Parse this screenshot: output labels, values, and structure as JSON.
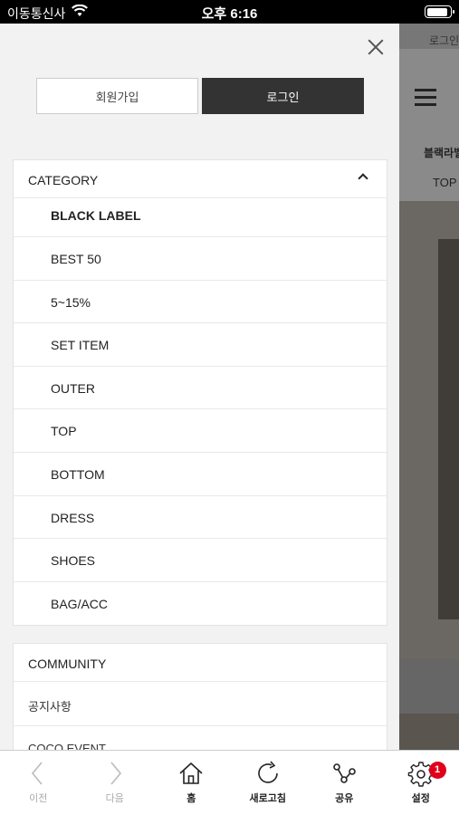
{
  "status_bar": {
    "carrier": "이동통신사",
    "time": "오후 6:16",
    "battery_level": 0.95
  },
  "background_page": {
    "login_label": "로그인",
    "label_1": "블랙라벨",
    "label_2": "TOP"
  },
  "drawer": {
    "join_label": "회원가입",
    "login_label": "로그인",
    "category": {
      "title": "CATEGORY",
      "items": [
        "BLACK LABEL",
        "BEST 50",
        "5~15%",
        "SET ITEM",
        "OUTER",
        "TOP",
        "BOTTOM",
        "DRESS",
        "SHOES",
        "BAG/ACC"
      ]
    },
    "community": {
      "title": "COMMUNITY",
      "items": [
        "공지사항",
        "COCO EVENT"
      ]
    }
  },
  "toolbar": {
    "items": [
      {
        "label": "이전",
        "icon": "chevron-left-icon",
        "enabled": false
      },
      {
        "label": "다음",
        "icon": "chevron-right-icon",
        "enabled": false
      },
      {
        "label": "홈",
        "icon": "home-icon",
        "enabled": true
      },
      {
        "label": "새로고침",
        "icon": "refresh-icon",
        "enabled": true
      },
      {
        "label": "공유",
        "icon": "share-icon",
        "enabled": true
      },
      {
        "label": "설정",
        "icon": "gear-icon",
        "enabled": true,
        "badge": "1"
      }
    ]
  },
  "colors": {
    "accent_dark": "#333333",
    "badge": "#e0001b",
    "drawer_bg": "#f2f2f2"
  }
}
